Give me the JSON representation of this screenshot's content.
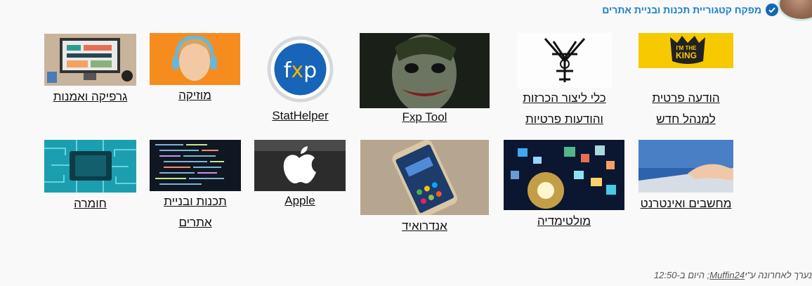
{
  "header": {
    "title": "מפקח קטגוריית תכנות ובניית אתרים"
  },
  "row1": [
    {
      "id": "private-message",
      "label_lines": [
        "הודעה פרטית",
        "למנהל חדש"
      ],
      "icon": "im-the-king-image"
    },
    {
      "id": "banner-tools",
      "label_lines": [
        "כלי ליצור הכרזות",
        "והודעות פרטיות"
      ],
      "icon": "symbol-sketch-image"
    },
    {
      "id": "fxp-tool",
      "label_lines": [
        "Fxp Tool"
      ],
      "icon": "joker-image"
    },
    {
      "id": "stathelper",
      "label_lines": [
        "StatHelper"
      ],
      "icon": "fxp-logo"
    },
    {
      "id": "music",
      "label_lines": [
        "מוזיקה"
      ],
      "icon": "headphones-girl-image"
    },
    {
      "id": "graphics",
      "label_lines": [
        "גרפיקה ואמנות"
      ],
      "icon": "graphics-desk-image"
    }
  ],
  "row2": [
    {
      "id": "computers",
      "label_lines": [
        "מחשבים ואינטרנט"
      ],
      "icon": "laptop-hand-image"
    },
    {
      "id": "multimedia",
      "label_lines": [
        "מולטימדיה"
      ],
      "icon": "multimedia-icons-image"
    },
    {
      "id": "android",
      "label_lines": [
        "אנדרואיד"
      ],
      "icon": "android-phone-image"
    },
    {
      "id": "apple",
      "label_lines": [
        "Apple"
      ],
      "icon": "apple-logo-image"
    },
    {
      "id": "programming",
      "label_lines": [
        "תכנות ובניית",
        "אתרים"
      ],
      "icon": "code-screen-image"
    },
    {
      "id": "hardware",
      "label_lines": [
        "חומרה"
      ],
      "icon": "circuit-chip-image"
    }
  ],
  "footer": {
    "prefix": "נערך לאחרונה ע\"י",
    "user": "Muffin24",
    "suffix": "; היום ב-12:50"
  }
}
